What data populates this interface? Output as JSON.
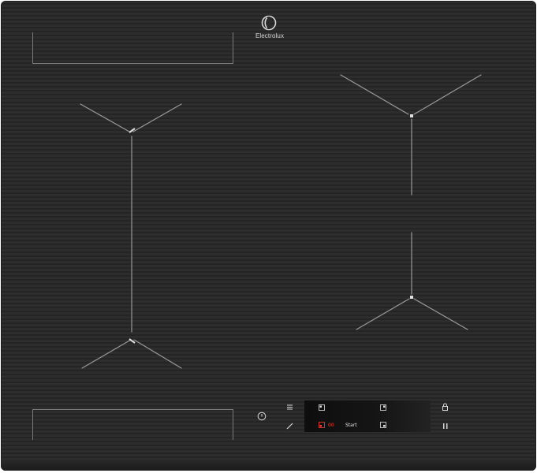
{
  "brand": {
    "name": "Electrolux",
    "icon": "electrolux-logo-icon"
  },
  "cooking_zones": [
    {
      "id": "top-left-bridge-zone",
      "icon": "rectangle-zone-outline"
    },
    {
      "id": "left-flex-zone",
      "icon": "flex-zone-marker"
    },
    {
      "id": "top-right-zone",
      "icon": "zone-center-marker"
    },
    {
      "id": "bottom-right-zone",
      "icon": "zone-center-marker"
    },
    {
      "id": "bottom-left-bridge-zone",
      "icon": "rectangle-zone-outline"
    }
  ],
  "controls": {
    "power": {
      "icon": "power-icon"
    },
    "menu": {
      "icon": "menu-icon"
    },
    "edit": {
      "icon": "pencil-icon"
    },
    "lock": {
      "icon": "lock-icon"
    },
    "pause": {
      "icon": "pause-icon"
    },
    "display": {
      "timer_value": "00",
      "start_label": "Start",
      "icons": [
        "zone-top-left-select-icon",
        "zone-top-right-select-icon",
        "zone-bottom-left-select-icon",
        "zone-bottom-right-select-icon"
      ]
    }
  },
  "colors": {
    "surface": "#2b2b2b",
    "marking": "#9a9a9a",
    "display_accent": "#ff3b2f"
  }
}
